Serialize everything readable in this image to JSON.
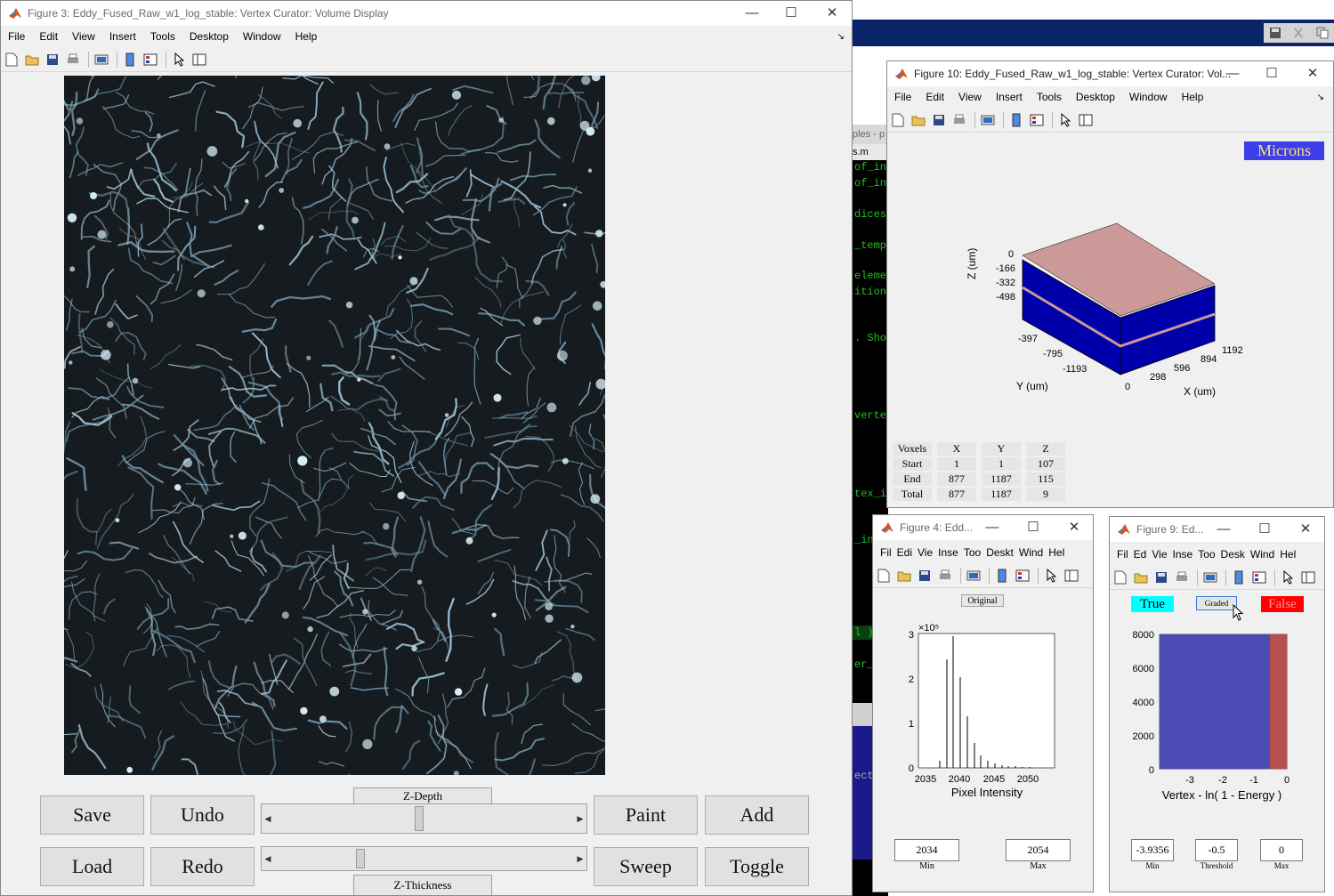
{
  "menu_labels": [
    "File",
    "Edit",
    "View",
    "Insert",
    "Tools",
    "Desktop",
    "Window",
    "Help"
  ],
  "fig3": {
    "title": "Figure 3: Eddy_Fused_Raw_w1_log_stable: Vertex Curator: Volume Display",
    "buttons": {
      "save": "Save",
      "undo": "Undo",
      "paint": "Paint",
      "add": "Add",
      "load": "Load",
      "redo": "Redo",
      "sweep": "Sweep",
      "toggle": "Toggle"
    },
    "zdepth_label": "Z-Depth",
    "zthickness_label": "Z-Thickness",
    "zdepth_value": 0.48,
    "zthickness_value": 0.28
  },
  "fig10": {
    "title": "Figure 10: Eddy_Fused_Raw_w1_log_stable: Vertex Curator: Vol...",
    "units_label": "Microns",
    "z_axis_label": "Z (um)",
    "y_axis_label": "Y (um)",
    "x_axis_label": "X (um)",
    "z_ticks": [
      "0",
      "-166",
      "-332",
      "-498"
    ],
    "y_ticks": [
      "-397",
      "-795",
      "-1193",
      "0"
    ],
    "x_ticks": [
      "298",
      "596",
      "894",
      "1192"
    ],
    "table": {
      "headers": [
        "Voxels",
        "X",
        "Y",
        "Z"
      ],
      "rows": [
        [
          "Start",
          "1",
          "1",
          "107"
        ],
        [
          "End",
          "877",
          "1187",
          "115"
        ],
        [
          "Total",
          "877",
          "1187",
          "9"
        ]
      ]
    }
  },
  "fig4": {
    "title": "Figure 4: Edd...",
    "menu": [
      "Fil",
      "Edi",
      "Vie",
      "Inse",
      "Too",
      "Deskt",
      "Wind",
      "Hel"
    ],
    "mode_label": "Original",
    "exponent_label": "×10⁵",
    "y_ticks": [
      "3",
      "2",
      "1",
      "0"
    ],
    "x_ticks": [
      "2035",
      "2040",
      "2045",
      "2050"
    ],
    "xlabel": "Pixel Intensity",
    "min_value": "2034",
    "max_value": "2054",
    "min_label": "Min",
    "max_label": "Max"
  },
  "fig9": {
    "title": "Figure 9: Ed...",
    "menu": [
      "Fil",
      "Ed",
      "Vie",
      "Inse",
      "Too",
      "Desk",
      "Wind",
      "Hel"
    ],
    "true_label": "True",
    "graded_label": "Graded",
    "false_label": "False",
    "y_ticks": [
      "8000",
      "6000",
      "4000",
      "2000",
      "0"
    ],
    "x_ticks": [
      "-3",
      "-2",
      "-1",
      "0"
    ],
    "xlabel": "Vertex - ln( 1 - Energy )",
    "min_value": "-3.9356",
    "threshold_value": "-0.5",
    "max_value": "0",
    "min_label": "Min",
    "threshold_label": "Threshold",
    "max_label": "Max"
  },
  "editor": {
    "tabs": "ples - p",
    "file": "s.m",
    "lines": [
      "of_in",
      "of_in",
      "dices",
      "_temp",
      "eleme",
      "ition",
      ". Sho",
      "verte",
      "tex_i",
      "_in",
      "l )",
      "er_",
      "ect"
    ]
  },
  "colors": {
    "volume_top": "#cc9999",
    "volume_side": "#0000aa",
    "true_color": "#00ffff",
    "false_color": "#ff0000",
    "hist_blue": "#4b4bb4",
    "hist_red": "#b45050"
  }
}
